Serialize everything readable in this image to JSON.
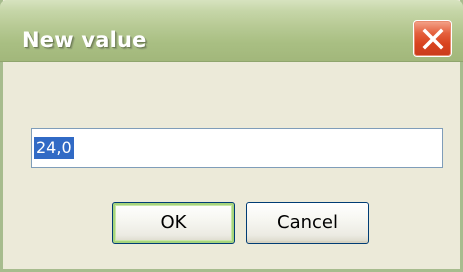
{
  "dialog": {
    "title": "New value",
    "close_icon": "close-x-icon",
    "input": {
      "value": "24,0",
      "selected": true
    },
    "ok_label": "OK",
    "cancel_label": "Cancel"
  }
}
